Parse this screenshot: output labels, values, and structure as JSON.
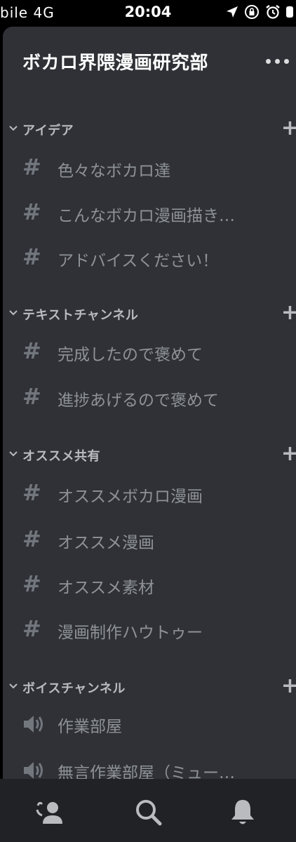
{
  "status_bar": {
    "carrier": "bile  4G",
    "time": "20:04",
    "icons": [
      "location-arrow-icon",
      "orientation-lock-icon",
      "alarm-icon",
      "battery-icon"
    ]
  },
  "server": {
    "name": "ボカロ界隈漫画研究部",
    "menu_icon": "more-dots-icon"
  },
  "categories": [
    {
      "label": "アイデア",
      "channels": [
        "色々なボカロ達",
        "こんなボカロ漫画描き…",
        "アドバイスください！"
      ]
    },
    {
      "label": "テキストチャンネル",
      "channels": [
        "完成したので褒めて",
        "進捗あげるので褒めて"
      ]
    },
    {
      "label": "オススメ共有",
      "channels": [
        "オススメボカロ漫画",
        "オススメ漫画",
        "オススメ素材",
        "漫画制作ハウトゥー"
      ]
    },
    {
      "label": "ボイスチャンネル",
      "voice_channels": [
        "作業部屋",
        "無言作業部屋（ミュー…"
      ]
    }
  ],
  "symbols": {
    "hash": "#",
    "plus": "+"
  },
  "tab_bar": {
    "tabs": [
      "friends-icon",
      "search-icon",
      "notifications-bell-icon"
    ]
  },
  "colors": {
    "panel_bg": "#2f3136",
    "tabbar_bg": "#202225",
    "channel_text": "#8e9297",
    "category_text": "#b9bbbe"
  }
}
